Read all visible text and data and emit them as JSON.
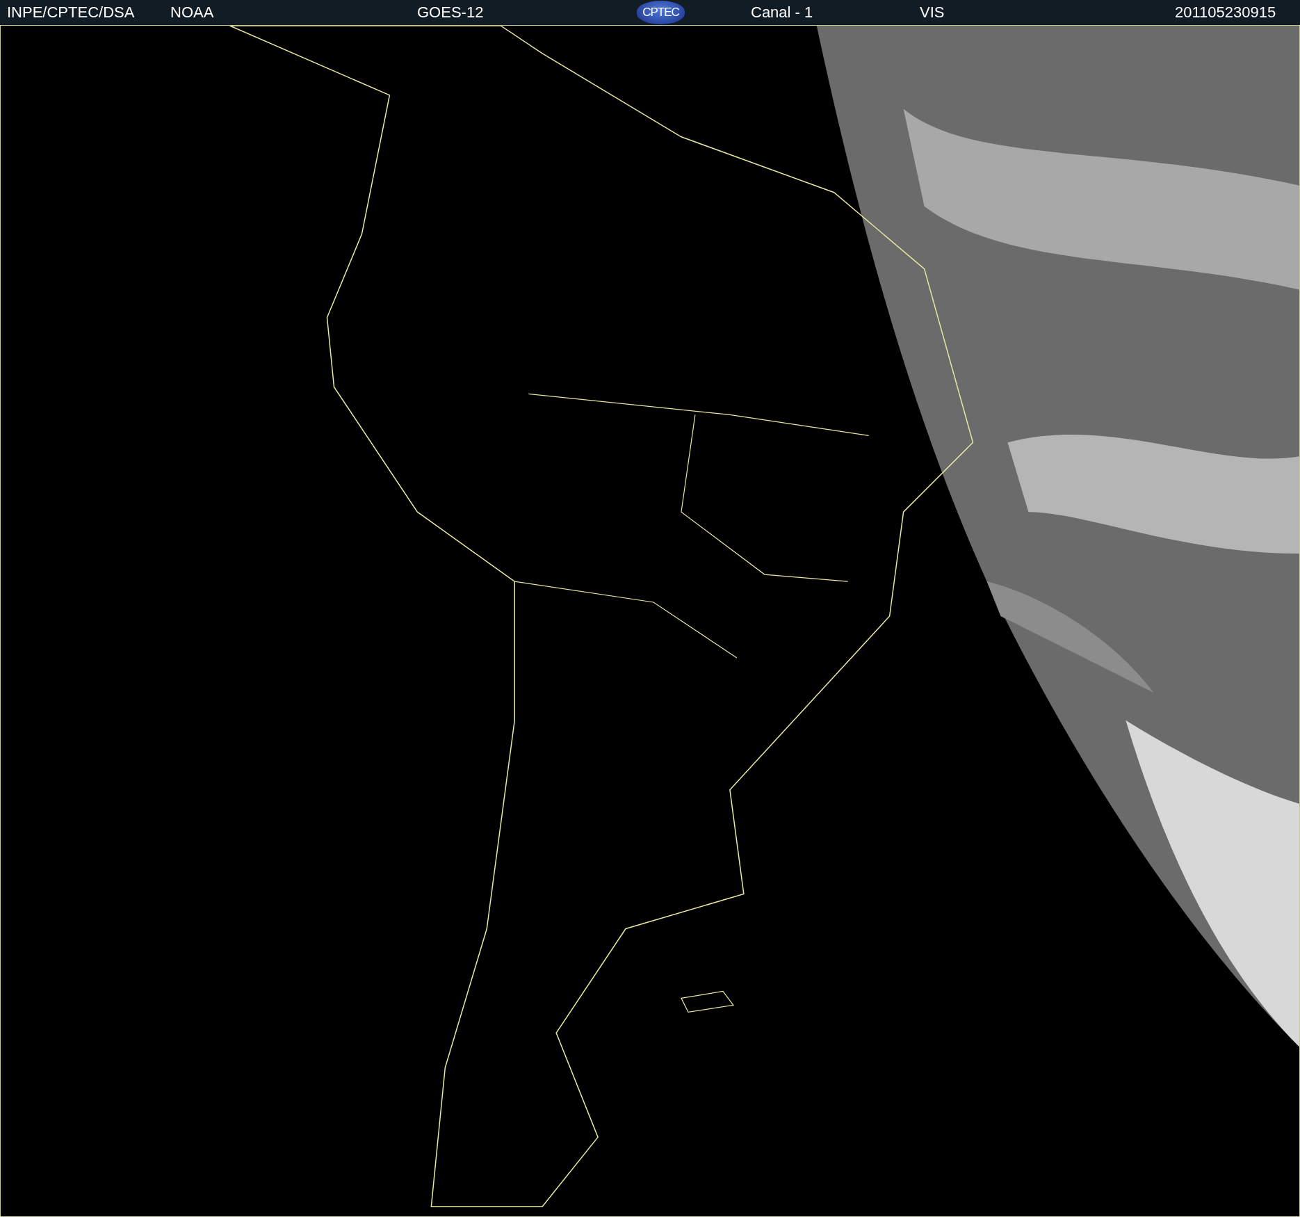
{
  "header": {
    "items": [
      {
        "kind": "text",
        "text": "INPE/CPTEC/DSA"
      },
      {
        "kind": "text",
        "text": "NOAA"
      },
      {
        "kind": "text",
        "text": "GOES-12"
      },
      {
        "kind": "logo",
        "text": "CPTEC"
      },
      {
        "kind": "text",
        "text": "Canal - 1"
      },
      {
        "kind": "text",
        "text": "VIS"
      },
      {
        "kind": "text",
        "text": "201105230915"
      }
    ]
  }
}
